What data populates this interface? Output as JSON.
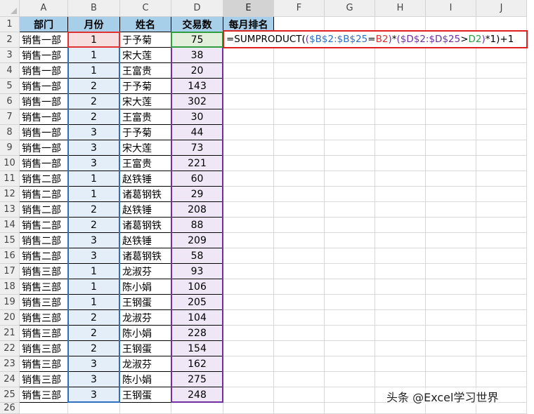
{
  "columns": [
    "A",
    "B",
    "C",
    "D",
    "E",
    "F",
    "G",
    "H",
    "I",
    "J"
  ],
  "header_row": [
    "部门",
    "月份",
    "姓名",
    "交易数",
    "每月排名"
  ],
  "rows": [
    [
      "销售一部",
      "1",
      "于予菊",
      "75"
    ],
    [
      "销售一部",
      "1",
      "宋大莲",
      "38"
    ],
    [
      "销售一部",
      "1",
      "王富贵",
      "20"
    ],
    [
      "销售一部",
      "2",
      "于予菊",
      "143"
    ],
    [
      "销售一部",
      "2",
      "宋大莲",
      "302"
    ],
    [
      "销售一部",
      "2",
      "王富贵",
      "30"
    ],
    [
      "销售一部",
      "3",
      "于予菊",
      "44"
    ],
    [
      "销售一部",
      "3",
      "宋大莲",
      "73"
    ],
    [
      "销售一部",
      "3",
      "王富贵",
      "221"
    ],
    [
      "销售二部",
      "1",
      "赵铁锤",
      "60"
    ],
    [
      "销售二部",
      "1",
      "诸葛钢铁",
      "29"
    ],
    [
      "销售二部",
      "2",
      "赵铁锤",
      "208"
    ],
    [
      "销售二部",
      "2",
      "诸葛钢铁",
      "88"
    ],
    [
      "销售二部",
      "3",
      "赵铁锤",
      "209"
    ],
    [
      "销售二部",
      "3",
      "诸葛钢铁",
      "58"
    ],
    [
      "销售三部",
      "1",
      "龙淑芬",
      "93"
    ],
    [
      "销售三部",
      "1",
      "陈小娟",
      "106"
    ],
    [
      "销售三部",
      "1",
      "王钢蛋",
      "205"
    ],
    [
      "销售三部",
      "2",
      "龙淑芬",
      "104"
    ],
    [
      "销售三部",
      "2",
      "陈小娟",
      "228"
    ],
    [
      "销售三部",
      "2",
      "王钢蛋",
      "154"
    ],
    [
      "销售三部",
      "3",
      "龙淑芬",
      "162"
    ],
    [
      "销售三部",
      "3",
      "陈小娟",
      "275"
    ],
    [
      "销售三部",
      "3",
      "王钢蛋",
      "248"
    ]
  ],
  "formula": {
    "parts": [
      {
        "t": "=SUMPRODUCT(",
        "c": "#000000"
      },
      {
        "t": "(",
        "c": "#7030a0"
      },
      {
        "t": "$B$2:$B$25",
        "c": "#2f6fbf"
      },
      {
        "t": "=",
        "c": "#000000"
      },
      {
        "t": "B2",
        "c": "#e03030"
      },
      {
        "t": ")",
        "c": "#7030a0"
      },
      {
        "t": "*",
        "c": "#000000"
      },
      {
        "t": "(",
        "c": "#7030a0"
      },
      {
        "t": "$D$2:$D$25",
        "c": "#7030a0"
      },
      {
        "t": ">",
        "c": "#000000"
      },
      {
        "t": "D2",
        "c": "#2e9d3f"
      },
      {
        "t": ")",
        "c": "#7030a0"
      },
      {
        "t": "*1)+1",
        "c": "#000000"
      }
    ]
  },
  "watermark": "头条 @Excel学习世界",
  "colors": {
    "header_fill": "#a7cfe9",
    "d2_fill": "#e2efda",
    "d_range_fill": "#efe7f5",
    "b2_fill": "#f7dede",
    "b_range_fill": "#e3eef8",
    "ref_blue": "#2f6fbf",
    "ref_red": "#e03030",
    "ref_purple": "#7030a0",
    "ref_green": "#2e9d3f",
    "formula_border": "#e02020"
  }
}
